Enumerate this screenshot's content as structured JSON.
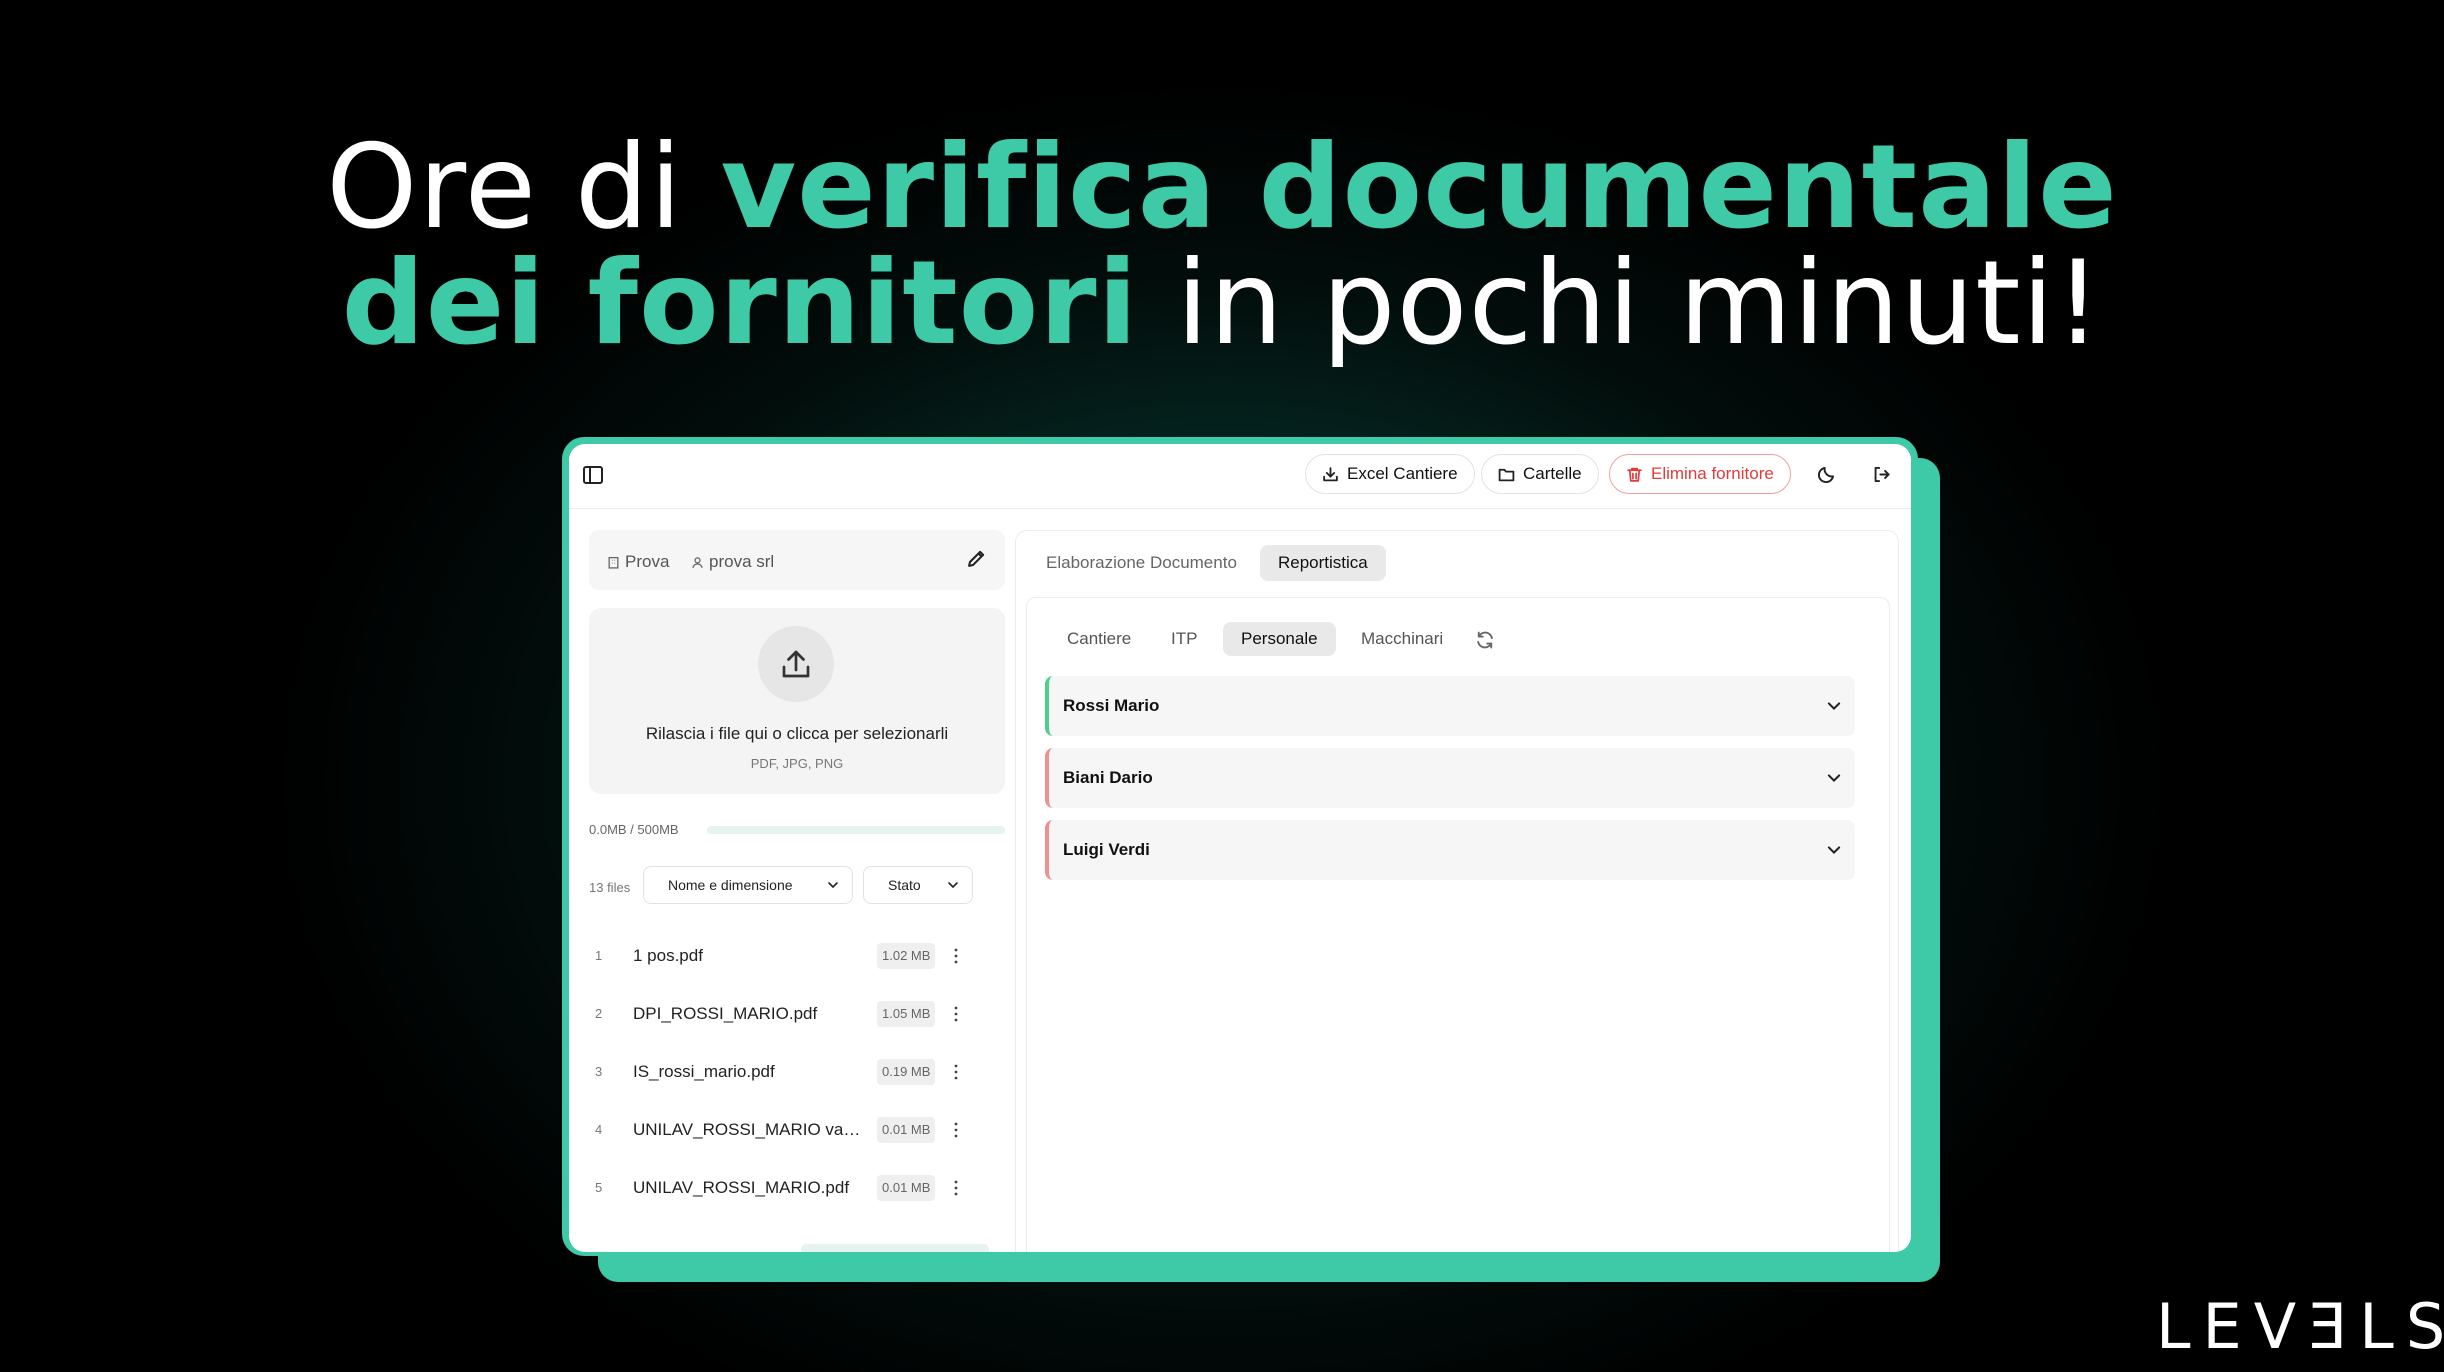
{
  "headline": {
    "line1_plain": "Ore di ",
    "line1_highlight": "verifica documentale",
    "line2_highlight": "dei fornitori",
    "line2_plain": " in pochi minuti!"
  },
  "colors": {
    "accent": "#3ec9a7",
    "danger": "#e23b3b",
    "ok_border": "#4cd08a",
    "ko_border": "#f09090"
  },
  "toolbar": {
    "excel_label": "Excel Cantiere",
    "folders_label": "Cartelle",
    "delete_label": "Elimina fornitore",
    "icons": [
      "sidebar-toggle-icon",
      "download-icon",
      "folder-icon",
      "trash-icon",
      "moon-icon",
      "logout-icon"
    ]
  },
  "breadcrumb": {
    "project": "Prova",
    "supplier": "prova srl"
  },
  "dropzone": {
    "title": "Rilascia i file qui o clicca per selezionarli",
    "formats": "PDF, JPG, PNG"
  },
  "storage": {
    "label": "0.0MB / 500MB",
    "used_fraction": 0.0
  },
  "files": {
    "count_label": "13 files",
    "sort_label": "Nome e dimensione",
    "status_label": "Stato",
    "items": [
      {
        "index": "1",
        "name": "1 pos.pdf",
        "size": "1.02 MB"
      },
      {
        "index": "2",
        "name": "DPI_ROSSI_MARIO.pdf",
        "size": "1.05 MB"
      },
      {
        "index": "3",
        "name": "IS_rossi_mario.pdf",
        "size": "0.19 MB"
      },
      {
        "index": "4",
        "name": "UNILAV_ROSSI_MARIO valid…",
        "size": "0.01 MB"
      },
      {
        "index": "5",
        "name": "UNILAV_ROSSI_MARIO.pdf",
        "size": "0.01 MB"
      }
    ]
  },
  "main_tabs": [
    {
      "label": "Elaborazione Documento",
      "active": false
    },
    {
      "label": "Reportistica",
      "active": true
    }
  ],
  "sub_tabs": [
    {
      "label": "Cantiere",
      "active": false
    },
    {
      "label": "ITP",
      "active": false
    },
    {
      "label": "Personale",
      "active": true
    },
    {
      "label": "Macchinari",
      "active": false
    }
  ],
  "personnel": [
    {
      "name": "Rossi Mario",
      "status": "ok"
    },
    {
      "name": "Biani Dario",
      "status": "ko"
    },
    {
      "name": "Luigi Verdi",
      "status": "ko"
    }
  ],
  "logo": "LEVƎLS"
}
